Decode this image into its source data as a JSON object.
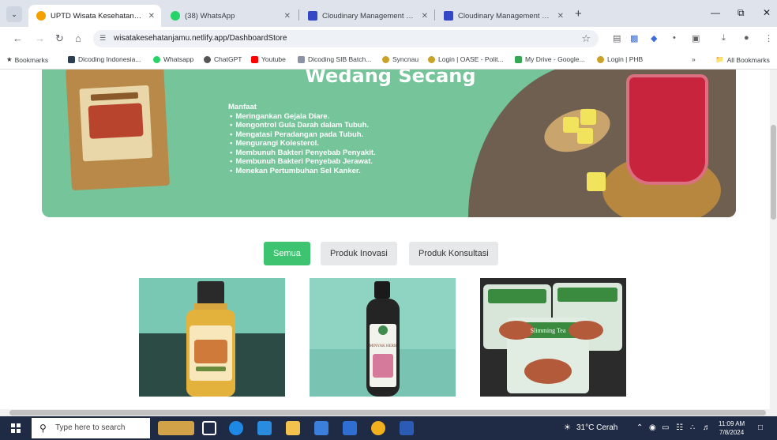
{
  "browser": {
    "tabs": [
      {
        "title": "UPTD Wisata Kesehatan Jamu",
        "favicon_color": "#f4a100",
        "active": true
      },
      {
        "title": "(38) WhatsApp",
        "favicon_color": "#25d366",
        "active": false
      },
      {
        "title": "Cloudinary Management Cons",
        "favicon_color": "#3448c5",
        "active": false
      },
      {
        "title": "Cloudinary Management Cons",
        "favicon_color": "#3448c5",
        "active": false
      }
    ],
    "new_tab": "+",
    "url": "wisatakesehatanjamu.netlify.app/DashboardStore",
    "bookmarks_label": "Bookmarks",
    "bookmarks": [
      {
        "label": "Dicoding Indonesia...",
        "color": "#2d3e50"
      },
      {
        "label": "Whatsapp",
        "color": "#25d366"
      },
      {
        "label": "ChatGPT",
        "color": "#555555"
      },
      {
        "label": "Youtube",
        "color": "#ff0000"
      },
      {
        "label": "Dicoding SIB Batch...",
        "color": "#8a94a6"
      },
      {
        "label": "Syncnau",
        "color": "#c9a227"
      },
      {
        "label": "Login | OASE - Polit...",
        "color": "#c9a227"
      },
      {
        "label": "My Drive - Google...",
        "color": "#34a853"
      },
      {
        "label": "Login | PHB",
        "color": "#c9a227"
      }
    ],
    "overflow": "»",
    "all_bookmarks": "All Bookmarks"
  },
  "hero": {
    "title": "Wedang Secang",
    "benefit_heading": "Manfaat",
    "benefits": [
      "Meringankan Gejala Diare.",
      "Mengontrol Gula Darah dalam Tubuh.",
      "Mengatasi Peradangan pada Tubuh.",
      "Mengurangi Kolesterol.",
      "Membunuh Bakteri Penyebab Penyakit.",
      "Membunuh Bakteri Penyebab Jerawat.",
      "Menekan Pertumbuhan Sel Kanker."
    ]
  },
  "filters": {
    "all": "Semua",
    "innovation": "Produk Inovasi",
    "consultation": "Produk Konsultasi"
  },
  "products": [
    {
      "image": "oil-bottle"
    },
    {
      "image": "dark-bottle",
      "bottle_label": "MINYAK HERB"
    },
    {
      "image": "slimming-tea-packs",
      "pack_label": "Slimming Tea"
    }
  ],
  "taskbar": {
    "search_placeholder": "Type here to search",
    "weather": "31°C  Cerah",
    "time": "11:09 AM",
    "date": "7/8/2024"
  },
  "colors": {
    "hero_green": "#75c49a",
    "active_filter": "#3ec470"
  }
}
